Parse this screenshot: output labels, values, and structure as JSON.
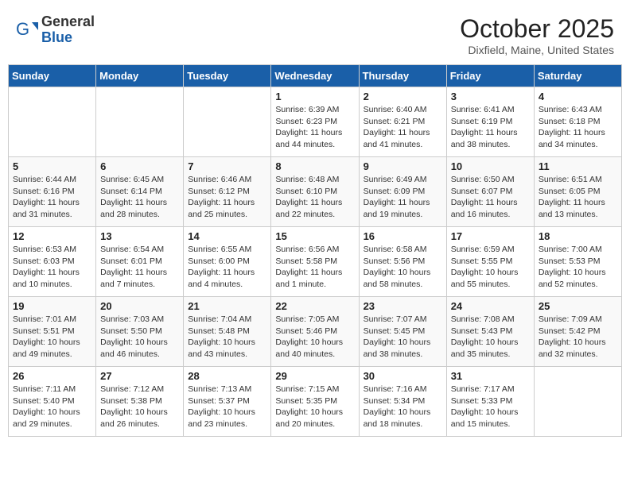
{
  "header": {
    "logo_general": "General",
    "logo_blue": "Blue",
    "month_title": "October 2025",
    "location": "Dixfield, Maine, United States"
  },
  "days_of_week": [
    "Sunday",
    "Monday",
    "Tuesday",
    "Wednesday",
    "Thursday",
    "Friday",
    "Saturday"
  ],
  "weeks": [
    [
      {
        "day": "",
        "info": ""
      },
      {
        "day": "",
        "info": ""
      },
      {
        "day": "",
        "info": ""
      },
      {
        "day": "1",
        "info": "Sunrise: 6:39 AM\nSunset: 6:23 PM\nDaylight: 11 hours\nand 44 minutes."
      },
      {
        "day": "2",
        "info": "Sunrise: 6:40 AM\nSunset: 6:21 PM\nDaylight: 11 hours\nand 41 minutes."
      },
      {
        "day": "3",
        "info": "Sunrise: 6:41 AM\nSunset: 6:19 PM\nDaylight: 11 hours\nand 38 minutes."
      },
      {
        "day": "4",
        "info": "Sunrise: 6:43 AM\nSunset: 6:18 PM\nDaylight: 11 hours\nand 34 minutes."
      }
    ],
    [
      {
        "day": "5",
        "info": "Sunrise: 6:44 AM\nSunset: 6:16 PM\nDaylight: 11 hours\nand 31 minutes."
      },
      {
        "day": "6",
        "info": "Sunrise: 6:45 AM\nSunset: 6:14 PM\nDaylight: 11 hours\nand 28 minutes."
      },
      {
        "day": "7",
        "info": "Sunrise: 6:46 AM\nSunset: 6:12 PM\nDaylight: 11 hours\nand 25 minutes."
      },
      {
        "day": "8",
        "info": "Sunrise: 6:48 AM\nSunset: 6:10 PM\nDaylight: 11 hours\nand 22 minutes."
      },
      {
        "day": "9",
        "info": "Sunrise: 6:49 AM\nSunset: 6:09 PM\nDaylight: 11 hours\nand 19 minutes."
      },
      {
        "day": "10",
        "info": "Sunrise: 6:50 AM\nSunset: 6:07 PM\nDaylight: 11 hours\nand 16 minutes."
      },
      {
        "day": "11",
        "info": "Sunrise: 6:51 AM\nSunset: 6:05 PM\nDaylight: 11 hours\nand 13 minutes."
      }
    ],
    [
      {
        "day": "12",
        "info": "Sunrise: 6:53 AM\nSunset: 6:03 PM\nDaylight: 11 hours\nand 10 minutes."
      },
      {
        "day": "13",
        "info": "Sunrise: 6:54 AM\nSunset: 6:01 PM\nDaylight: 11 hours\nand 7 minutes."
      },
      {
        "day": "14",
        "info": "Sunrise: 6:55 AM\nSunset: 6:00 PM\nDaylight: 11 hours\nand 4 minutes."
      },
      {
        "day": "15",
        "info": "Sunrise: 6:56 AM\nSunset: 5:58 PM\nDaylight: 11 hours\nand 1 minute."
      },
      {
        "day": "16",
        "info": "Sunrise: 6:58 AM\nSunset: 5:56 PM\nDaylight: 10 hours\nand 58 minutes."
      },
      {
        "day": "17",
        "info": "Sunrise: 6:59 AM\nSunset: 5:55 PM\nDaylight: 10 hours\nand 55 minutes."
      },
      {
        "day": "18",
        "info": "Sunrise: 7:00 AM\nSunset: 5:53 PM\nDaylight: 10 hours\nand 52 minutes."
      }
    ],
    [
      {
        "day": "19",
        "info": "Sunrise: 7:01 AM\nSunset: 5:51 PM\nDaylight: 10 hours\nand 49 minutes."
      },
      {
        "day": "20",
        "info": "Sunrise: 7:03 AM\nSunset: 5:50 PM\nDaylight: 10 hours\nand 46 minutes."
      },
      {
        "day": "21",
        "info": "Sunrise: 7:04 AM\nSunset: 5:48 PM\nDaylight: 10 hours\nand 43 minutes."
      },
      {
        "day": "22",
        "info": "Sunrise: 7:05 AM\nSunset: 5:46 PM\nDaylight: 10 hours\nand 40 minutes."
      },
      {
        "day": "23",
        "info": "Sunrise: 7:07 AM\nSunset: 5:45 PM\nDaylight: 10 hours\nand 38 minutes."
      },
      {
        "day": "24",
        "info": "Sunrise: 7:08 AM\nSunset: 5:43 PM\nDaylight: 10 hours\nand 35 minutes."
      },
      {
        "day": "25",
        "info": "Sunrise: 7:09 AM\nSunset: 5:42 PM\nDaylight: 10 hours\nand 32 minutes."
      }
    ],
    [
      {
        "day": "26",
        "info": "Sunrise: 7:11 AM\nSunset: 5:40 PM\nDaylight: 10 hours\nand 29 minutes."
      },
      {
        "day": "27",
        "info": "Sunrise: 7:12 AM\nSunset: 5:38 PM\nDaylight: 10 hours\nand 26 minutes."
      },
      {
        "day": "28",
        "info": "Sunrise: 7:13 AM\nSunset: 5:37 PM\nDaylight: 10 hours\nand 23 minutes."
      },
      {
        "day": "29",
        "info": "Sunrise: 7:15 AM\nSunset: 5:35 PM\nDaylight: 10 hours\nand 20 minutes."
      },
      {
        "day": "30",
        "info": "Sunrise: 7:16 AM\nSunset: 5:34 PM\nDaylight: 10 hours\nand 18 minutes."
      },
      {
        "day": "31",
        "info": "Sunrise: 7:17 AM\nSunset: 5:33 PM\nDaylight: 10 hours\nand 15 minutes."
      },
      {
        "day": "",
        "info": ""
      }
    ]
  ]
}
